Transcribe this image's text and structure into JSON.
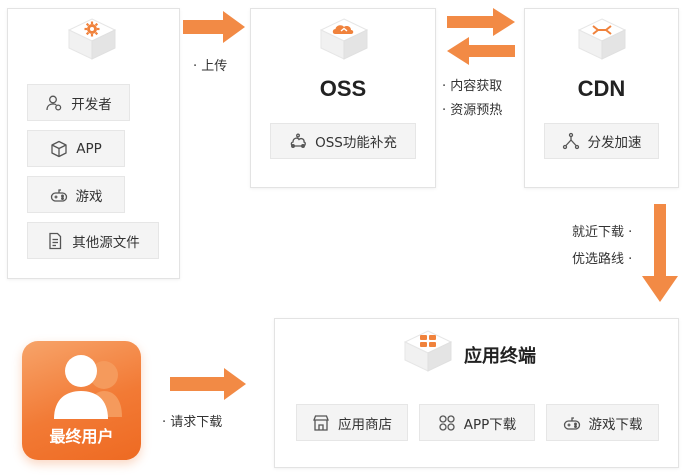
{
  "developer_panel": {
    "items": [
      {
        "label": "开发者",
        "icon": "developer-icon"
      },
      {
        "label": "APP",
        "icon": "cube-icon"
      },
      {
        "label": "游戏",
        "icon": "gamepad-icon"
      },
      {
        "label": "其他源文件",
        "icon": "file-icon"
      }
    ]
  },
  "oss": {
    "title": "OSS",
    "chip": "OSS功能补充",
    "icon": "cloud-icon"
  },
  "cdn": {
    "title": "CDN",
    "chip": "分发加速",
    "icon": "network-icon"
  },
  "terminal": {
    "title": "应用终端",
    "items": [
      {
        "label": "应用商店",
        "icon": "store-icon"
      },
      {
        "label": "APP下载",
        "icon": "grid-icon"
      },
      {
        "label": "游戏下载",
        "icon": "gamepad-icon"
      }
    ]
  },
  "end_user": {
    "label": "最终用户",
    "icon": "users-icon"
  },
  "annotations": {
    "upload": "· 上传",
    "fetch_1": "· 内容获取",
    "fetch_2": "· 资源预热",
    "nearby_1": "就近下载 ·",
    "nearby_2": "优选路线 ·",
    "request": "· 请求下载"
  },
  "colors": {
    "accent": "#f0823c",
    "arrow": "#f28a45",
    "chip_bg": "#f4f4f4",
    "border": "#e3e3e3"
  }
}
